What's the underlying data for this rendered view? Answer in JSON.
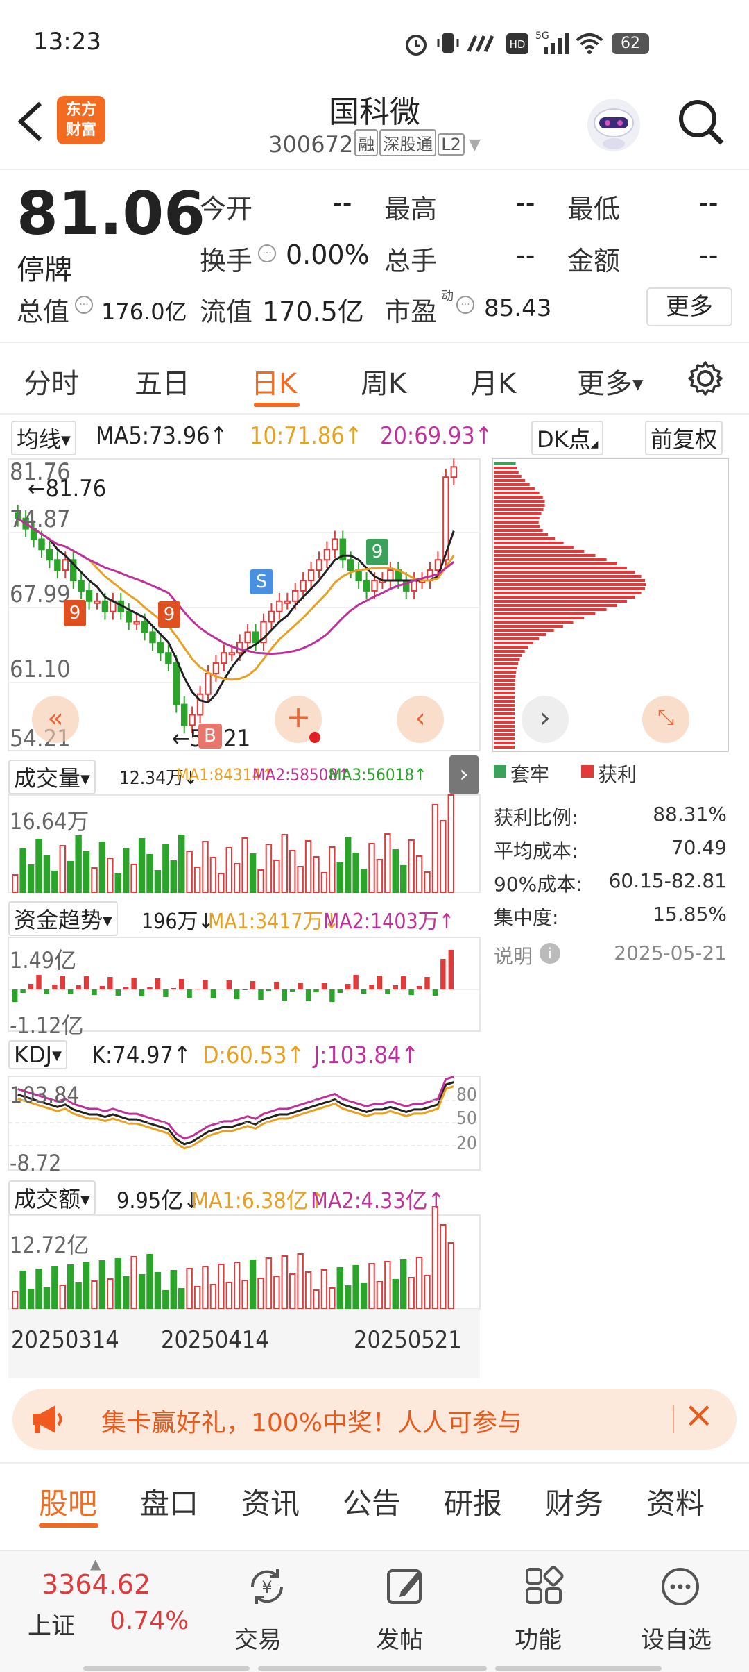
{
  "status": {
    "time": "13:23",
    "battery": "62"
  },
  "header": {
    "title": "国科微",
    "code": "300672",
    "tags": [
      "融",
      "深股通",
      "L2"
    ],
    "logo_line1": "东方",
    "logo_line2": "财富"
  },
  "quote": {
    "price": "81.06",
    "status": "停牌",
    "open_label": "今开",
    "open_val": "--",
    "high_label": "最高",
    "high_val": "--",
    "low_label": "最低",
    "low_val": "--",
    "turnover_label": "换手",
    "turnover_val": "0.00%",
    "volume_label": "总手",
    "volume_val": "--",
    "amount_label": "金额",
    "amount_val": "--",
    "mktcap_label": "总值",
    "mktcap_val": "176.0亿",
    "float_label": "流值",
    "float_val": "170.5亿",
    "pe_label": "市盈",
    "pe_sup": "动",
    "pe_val": "85.43",
    "more_btn": "更多"
  },
  "tabs": [
    "分时",
    "五日",
    "日K",
    "周K",
    "月K",
    "更多"
  ],
  "ma_bar": {
    "selector": "均线",
    "ma5": "MA5:73.96↑",
    "ma10": "10:71.86↑",
    "ma20": "20:69.93↑",
    "dk_btn": "DK点",
    "adj_btn": "前复权"
  },
  "kline": {
    "yticks": [
      "81.76",
      "74.87",
      "67.99",
      "61.10",
      "54.21"
    ],
    "high_marker": "←81.76",
    "low_marker": "←54.21",
    "signals": [
      "S",
      "B",
      "9",
      "9",
      "9"
    ]
  },
  "volume_bar": {
    "selector": "成交量",
    "val": "12.34万↓",
    "ma1": "MA1:84314↑",
    "ma2": "MA2:58508↑",
    "ma3": "MA3:56018↑",
    "ytop": "16.64万"
  },
  "fund_bar": {
    "selector": "资金趋势",
    "val": "196万↓",
    "ma1": "MA1:3417万↓",
    "ma2": "MA2:1403万↑",
    "ytop": "1.49亿",
    "ybot": "-1.12亿"
  },
  "kdj_bar": {
    "selector": "KDJ",
    "k": "K:74.97↑",
    "d": "D:60.53↑",
    "j": "J:103.84↑",
    "ytop": "103.84",
    "ybot": "-8.72",
    "r80": "80",
    "r50": "50",
    "r20": "20"
  },
  "amount_bar": {
    "selector": "成交额",
    "val": "9.95亿↓",
    "ma1": "MA1:6.38亿↑",
    "ma2": "MA2:4.33亿↑",
    "ytop": "12.72亿",
    "dates": [
      "20250314",
      "20250414",
      "20250521"
    ]
  },
  "chip": {
    "legend_trapped": "套牢",
    "legend_profit": "获利",
    "stats": [
      {
        "label": "获利比例:",
        "value": "88.31%"
      },
      {
        "label": "平均成本:",
        "value": "70.49"
      },
      {
        "label": "90%成本:",
        "value": "60.15-82.81"
      },
      {
        "label": "集中度:",
        "value": "15.85%"
      }
    ],
    "note_label": "说明",
    "date": "2025-05-21"
  },
  "banner": {
    "text": "集卡赢好礼，100%中奖！人人可参与"
  },
  "bottom_tabs": [
    "股吧",
    "盘口",
    "资讯",
    "公告",
    "研报",
    "财务",
    "资料"
  ],
  "nav": {
    "index_val": "3364.62",
    "index_name": "上证",
    "index_pct": "0.74%",
    "items": [
      "交易",
      "发帖",
      "功能",
      "设自选"
    ]
  },
  "colors": {
    "up": "#e03a3a",
    "down": "#2aa52a",
    "accent": "#f26b21"
  }
}
